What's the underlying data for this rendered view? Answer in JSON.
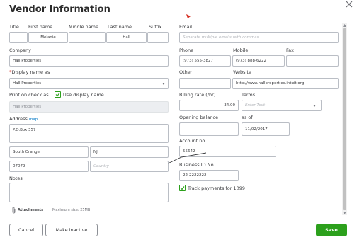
{
  "dialog": {
    "title": "Vendor Information"
  },
  "labels": {
    "title": "Title",
    "first_name": "First name",
    "middle_name": "Middle name",
    "last_name": "Last name",
    "suffix": "Suffix",
    "email": "Email",
    "company": "Company",
    "phone": "Phone",
    "mobile": "Mobile",
    "fax": "Fax",
    "display_name": "Display name as",
    "display_name_req": "*",
    "other": "Other",
    "website": "Website",
    "print_on_check": "Print on check as",
    "use_display_name": "Use display name",
    "billing_rate": "Billing rate (/hr)",
    "terms": "Terms",
    "address": "Address",
    "map_link": "map",
    "opening_balance": "Opening balance",
    "as_of": "as of",
    "account_no": "Account no.",
    "business_id": "Business ID No.",
    "track_payments": "Track payments for 1099",
    "notes": "Notes",
    "attachments": "Attachments",
    "max_size": "Maximum size: 25MB"
  },
  "fields": {
    "title": "",
    "first_name": "Melanie",
    "middle_name": "",
    "last_name": "Hall",
    "suffix": "",
    "email_placeholder": "Separate multiple emails with commas",
    "company": "Hall Properties",
    "phone": "(973) 555-3827",
    "mobile": "(973) 888-6222",
    "fax": "",
    "display_name": "Hall Properties",
    "other": "",
    "website": "http://www.hallproperties.intuit.org",
    "print_on_check": "Hall Properties",
    "billing_rate": "34.00",
    "terms_placeholder": "Enter Text",
    "street": "P.O.Box 357",
    "city": "South Orange",
    "state": "NJ",
    "zip": "07079",
    "country_placeholder": "Country",
    "opening_balance": "",
    "as_of": "11/02/2017",
    "account_no": "55642",
    "business_id": "22-2222222",
    "notes": ""
  },
  "checkboxes": {
    "use_display_name": true,
    "track_payments": true
  },
  "buttons": {
    "cancel": "Cancel",
    "make_inactive": "Make inactive",
    "save": "Save"
  },
  "colors": {
    "accent_green": "#2ca01c",
    "link_blue": "#0077c5",
    "required_red": "#d52b1e"
  }
}
